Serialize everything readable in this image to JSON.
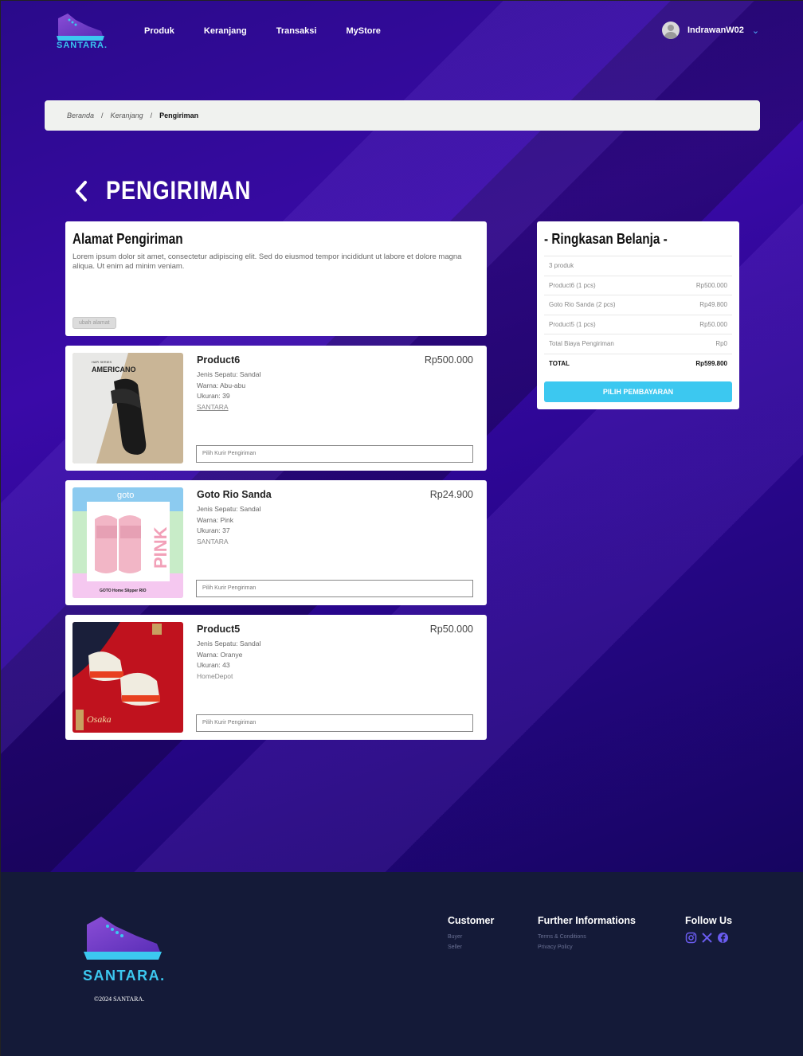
{
  "brand": {
    "name": "SANTARA.",
    "copyright": "©2024 SANTARA."
  },
  "nav": {
    "items": [
      "Produk",
      "Keranjang",
      "Transaksi",
      "MyStore"
    ]
  },
  "user": {
    "name": "IndrawanW02"
  },
  "breadcrumb": {
    "items": [
      "Beranda",
      "Keranjang",
      "Pengiriman"
    ]
  },
  "page": {
    "title": "PENGIRIMAN"
  },
  "address": {
    "heading": "Alamat Pengiriman",
    "text": "Lorem ipsum dolor sit amet, consectetur adipiscing elit. Sed do eiusmod tempor incididunt ut labore et dolore magna aliqua. Ut enim ad minim veniam.",
    "change_label": "ubah alamat"
  },
  "products": [
    {
      "name": "Product6",
      "price": "Rp500.000",
      "type": "Jenis Sepatu: Sandal",
      "color": "Warna: Abu-abu",
      "size": "Ukuran: 39",
      "store": "SANTARA",
      "courier_placeholder": "Pilih Kurir Pengiriman",
      "img_label": "AMERICANO",
      "img_sub": "HAPI SERIES"
    },
    {
      "name": "Goto Rio Sanda",
      "price": "Rp24.900",
      "type": "Jenis Sepatu: Sandal",
      "color": "Warna: Pink",
      "size": "Ukuran: 37",
      "store": "SANTARA",
      "courier_placeholder": "Pilih Kurir Pengiriman",
      "img_label": "goto",
      "img_side": "PINK",
      "img_caption": "GOTO Home Slipper RIO"
    },
    {
      "name": "Product5",
      "price": "Rp50.000",
      "type": "Jenis Sepatu: Sandal",
      "color": "Warna: Oranye",
      "size": "Ukuran: 43",
      "store": "HomeDepot",
      "courier_placeholder": "Pilih Kurir Pengiriman",
      "img_label": "Osaka"
    }
  ],
  "summary": {
    "title": "- Ringkasan Belanja -",
    "rows": [
      {
        "label": "3 produk",
        "value": ""
      },
      {
        "label": "Product6 (1 pcs)",
        "value": "Rp500.000"
      },
      {
        "label": "Goto Rio Sanda (2 pcs)",
        "value": "Rp49.800"
      },
      {
        "label": "Product5 (1 pcs)",
        "value": "Rp50.000"
      },
      {
        "label": "Total Biaya Pengiriman",
        "value": "Rp0"
      },
      {
        "label": "TOTAL",
        "value": "Rp599.800"
      }
    ],
    "pay_label": "PILIH PEMBAYARAN"
  },
  "footer": {
    "customer": {
      "heading": "Customer",
      "links": [
        "Buyer",
        "Seller"
      ]
    },
    "further": {
      "heading": "Further Informations",
      "links": [
        "Terms & Conditions",
        "Privacy Policy"
      ]
    },
    "follow": {
      "heading": "Follow Us",
      "icons": [
        "instagram-icon",
        "x-icon",
        "facebook-icon"
      ]
    }
  },
  "colors": {
    "accent": "#3cc8f0",
    "footer_bg": "#141a38",
    "hero_bg": "#2a0a8a"
  }
}
